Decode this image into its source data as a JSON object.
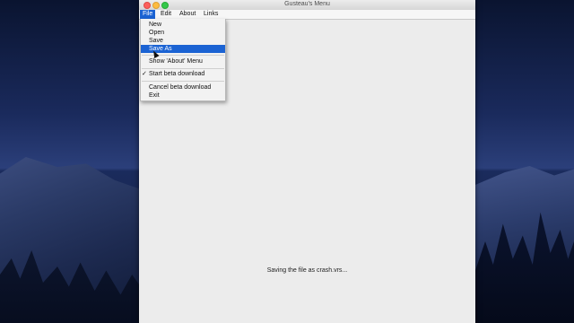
{
  "window": {
    "title": "Gusteau's Menu"
  },
  "menubar": {
    "items": [
      {
        "label": "File"
      },
      {
        "label": "Edit"
      },
      {
        "label": "About"
      },
      {
        "label": "Links"
      }
    ]
  },
  "file_menu": {
    "items": [
      {
        "label": "New"
      },
      {
        "label": "Open"
      },
      {
        "label": "Save"
      },
      {
        "label": "Save As",
        "highlighted": true
      },
      {
        "label": "Show 'About' Menu"
      },
      {
        "label": "Start beta download",
        "checked": true,
        "check_glyph": "✓"
      },
      {
        "label": "Cancel beta download"
      },
      {
        "label": "Exit"
      }
    ]
  },
  "status": {
    "text": "Saving the file as crash.vrs..."
  },
  "colors": {
    "selection": "#1b63d3",
    "window_bg": "#ececec"
  }
}
